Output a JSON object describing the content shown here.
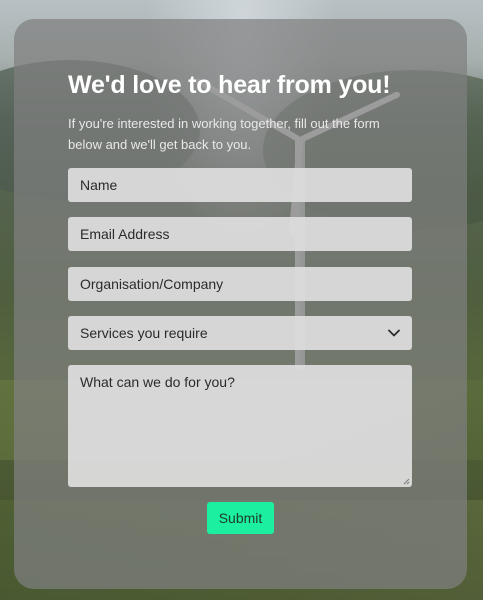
{
  "form": {
    "title": "We'd love to hear from you!",
    "subtitle": "If you're interested in working together, fill out the form below and we'll get back to you.",
    "fields": {
      "name_placeholder": "Name",
      "email_placeholder": "Email Address",
      "organisation_placeholder": "Organisation/Company",
      "services_selected": "Services you require",
      "message_placeholder": "What can we do for you?"
    },
    "submit_label": "Submit"
  },
  "colors": {
    "submit_background": "#1cf09e",
    "card_overlay": "#808080",
    "field_background": "#dedede"
  },
  "icons": {
    "select_chevron": "chevron-down-icon",
    "textarea_grip": "resize-grip-icon"
  }
}
